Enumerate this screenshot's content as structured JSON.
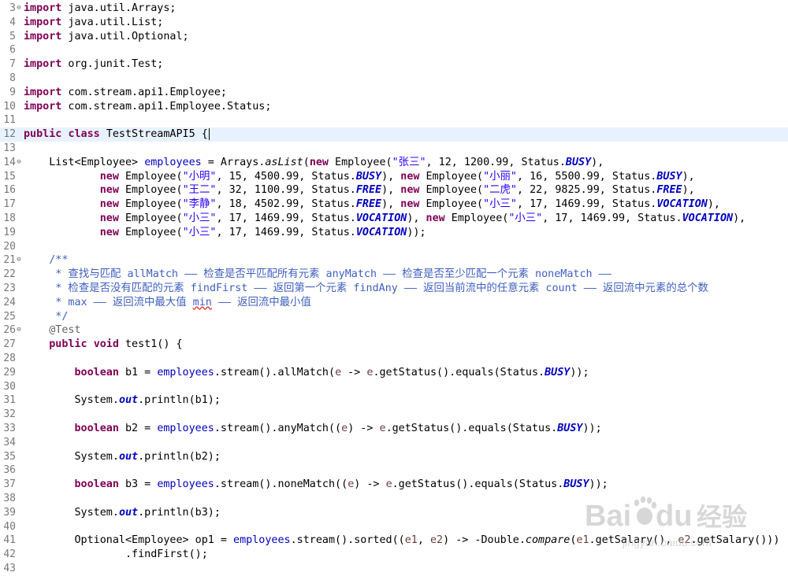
{
  "editor": {
    "lines": [
      {
        "n": "3",
        "fold": "⊖",
        "segments": [
          {
            "t": "import",
            "c": "k"
          },
          {
            "t": " java.util.Arrays;"
          }
        ]
      },
      {
        "n": "4",
        "segments": [
          {
            "t": "import",
            "c": "k"
          },
          {
            "t": " java.util.List;"
          }
        ]
      },
      {
        "n": "5",
        "segments": [
          {
            "t": "import",
            "c": "k"
          },
          {
            "t": " java.util.Optional;"
          }
        ]
      },
      {
        "n": "6",
        "segments": []
      },
      {
        "n": "7",
        "segments": [
          {
            "t": "import",
            "c": "k"
          },
          {
            "t": " org.junit.Test;"
          }
        ]
      },
      {
        "n": "8",
        "segments": []
      },
      {
        "n": "9",
        "segments": [
          {
            "t": "import",
            "c": "k"
          },
          {
            "t": " com.stream.api1.Employee;"
          }
        ]
      },
      {
        "n": "10",
        "segments": [
          {
            "t": "import",
            "c": "k"
          },
          {
            "t": " com.stream.api1.Employee.Status;"
          }
        ]
      },
      {
        "n": "11",
        "segments": []
      },
      {
        "n": "12",
        "current": true,
        "caret": true,
        "segments": [
          {
            "t": "public",
            "c": "k"
          },
          {
            "t": " "
          },
          {
            "t": "class",
            "c": "k"
          },
          {
            "t": " TestStreamAPI5 {"
          }
        ]
      },
      {
        "n": "13",
        "segments": []
      },
      {
        "n": "14",
        "fold": "⊖",
        "segments": [
          {
            "t": "    List<Employee> "
          },
          {
            "t": "employees",
            "c": "f"
          },
          {
            "t": " = Arrays."
          },
          {
            "t": "asList",
            "c": "m"
          },
          {
            "t": "("
          },
          {
            "t": "new",
            "c": "k"
          },
          {
            "t": " Employee("
          },
          {
            "t": "\"张三\"",
            "c": "s"
          },
          {
            "t": ", 12, 1200.99, Status."
          },
          {
            "t": "BUSY",
            "c": "fi"
          },
          {
            "t": "),"
          }
        ]
      },
      {
        "n": "15",
        "segments": [
          {
            "t": "            "
          },
          {
            "t": "new",
            "c": "k"
          },
          {
            "t": " Employee("
          },
          {
            "t": "\"小明\"",
            "c": "s"
          },
          {
            "t": ", 15, 4500.99, Status."
          },
          {
            "t": "BUSY",
            "c": "fi"
          },
          {
            "t": "), "
          },
          {
            "t": "new",
            "c": "k"
          },
          {
            "t": " Employee("
          },
          {
            "t": "\"小丽\"",
            "c": "s"
          },
          {
            "t": ", 16, 5500.99, Status."
          },
          {
            "t": "BUSY",
            "c": "fi"
          },
          {
            "t": "),"
          }
        ]
      },
      {
        "n": "16",
        "segments": [
          {
            "t": "            "
          },
          {
            "t": "new",
            "c": "k"
          },
          {
            "t": " Employee("
          },
          {
            "t": "\"王二\"",
            "c": "s"
          },
          {
            "t": ", 32, 1100.99, Status."
          },
          {
            "t": "FREE",
            "c": "fi"
          },
          {
            "t": "), "
          },
          {
            "t": "new",
            "c": "k"
          },
          {
            "t": " Employee("
          },
          {
            "t": "\"二虎\"",
            "c": "s"
          },
          {
            "t": ", 22, 9825.99, Status."
          },
          {
            "t": "FREE",
            "c": "fi"
          },
          {
            "t": "),"
          }
        ]
      },
      {
        "n": "17",
        "segments": [
          {
            "t": "            "
          },
          {
            "t": "new",
            "c": "k"
          },
          {
            "t": " Employee("
          },
          {
            "t": "\"李静\"",
            "c": "s"
          },
          {
            "t": ", 18, 4502.99, Status."
          },
          {
            "t": "FREE",
            "c": "fi"
          },
          {
            "t": "), "
          },
          {
            "t": "new",
            "c": "k"
          },
          {
            "t": " Employee("
          },
          {
            "t": "\"小三\"",
            "c": "s"
          },
          {
            "t": ", 17, 1469.99, Status."
          },
          {
            "t": "VOCATION",
            "c": "fi"
          },
          {
            "t": "),"
          }
        ]
      },
      {
        "n": "18",
        "segments": [
          {
            "t": "            "
          },
          {
            "t": "new",
            "c": "k"
          },
          {
            "t": " Employee("
          },
          {
            "t": "\"小三\"",
            "c": "s"
          },
          {
            "t": ", 17, 1469.99, Status."
          },
          {
            "t": "VOCATION",
            "c": "fi"
          },
          {
            "t": "), "
          },
          {
            "t": "new",
            "c": "k"
          },
          {
            "t": " Employee("
          },
          {
            "t": "\"小三\"",
            "c": "s"
          },
          {
            "t": ", 17, 1469.99, Status."
          },
          {
            "t": "VOCATION",
            "c": "fi"
          },
          {
            "t": "),"
          }
        ]
      },
      {
        "n": "19",
        "segments": [
          {
            "t": "            "
          },
          {
            "t": "new",
            "c": "k"
          },
          {
            "t": " Employee("
          },
          {
            "t": "\"小三\"",
            "c": "s"
          },
          {
            "t": ", 17, 1469.99, Status."
          },
          {
            "t": "VOCATION",
            "c": "fi"
          },
          {
            "t": "));"
          }
        ]
      },
      {
        "n": "20",
        "segments": []
      },
      {
        "n": "21",
        "fold": "⊖",
        "segments": [
          {
            "t": "    /**",
            "c": "c"
          }
        ]
      },
      {
        "n": "22",
        "segments": [
          {
            "t": "     * 查找与匹配 allMatch —— 检查是否平匹配所有元素 anyMatch —— 检查是否至少匹配一个元素 noneMatch ——",
            "c": "c"
          }
        ]
      },
      {
        "n": "23",
        "segments": [
          {
            "t": "     * 检查是否没有匹配的元素 findFirst —— 返回第一个元素 findAny —— 返回当前流中的任意元素 count —— 返回流中元素的总个数",
            "c": "c"
          }
        ]
      },
      {
        "n": "24",
        "segments": [
          {
            "t": "     * max —— 返回流中最大值 ",
            "c": "c"
          },
          {
            "t": "min",
            "c": "c sq"
          },
          {
            "t": " —— 返回流中最小值",
            "c": "c"
          }
        ]
      },
      {
        "n": "25",
        "segments": [
          {
            "t": "     */",
            "c": "c"
          }
        ]
      },
      {
        "n": "26",
        "fold": "⊖",
        "segments": [
          {
            "t": "    "
          },
          {
            "t": "@Test",
            "c": "a"
          }
        ]
      },
      {
        "n": "27",
        "segments": [
          {
            "t": "    "
          },
          {
            "t": "public",
            "c": "k"
          },
          {
            "t": " "
          },
          {
            "t": "void",
            "c": "k"
          },
          {
            "t": " test1() {"
          }
        ]
      },
      {
        "n": "28",
        "segments": []
      },
      {
        "n": "29",
        "segments": [
          {
            "t": "        "
          },
          {
            "t": "boolean",
            "c": "k"
          },
          {
            "t": " b1 = "
          },
          {
            "t": "employees",
            "c": "f"
          },
          {
            "t": ".stream().allMatch("
          },
          {
            "t": "e",
            "c": "v"
          },
          {
            "t": " -> "
          },
          {
            "t": "e",
            "c": "v"
          },
          {
            "t": ".getStatus().equals(Status."
          },
          {
            "t": "BUSY",
            "c": "fi"
          },
          {
            "t": "));"
          }
        ]
      },
      {
        "n": "30",
        "segments": []
      },
      {
        "n": "31",
        "segments": [
          {
            "t": "        System."
          },
          {
            "t": "out",
            "c": "fi"
          },
          {
            "t": ".println(b1);"
          }
        ]
      },
      {
        "n": "32",
        "segments": []
      },
      {
        "n": "33",
        "segments": [
          {
            "t": "        "
          },
          {
            "t": "boolean",
            "c": "k"
          },
          {
            "t": " b2 = "
          },
          {
            "t": "employees",
            "c": "f"
          },
          {
            "t": ".stream().anyMatch(("
          },
          {
            "t": "e",
            "c": "v"
          },
          {
            "t": ") -> "
          },
          {
            "t": "e",
            "c": "v"
          },
          {
            "t": ".getStatus().equals(Status."
          },
          {
            "t": "BUSY",
            "c": "fi"
          },
          {
            "t": "));"
          }
        ]
      },
      {
        "n": "34",
        "segments": []
      },
      {
        "n": "35",
        "segments": [
          {
            "t": "        System."
          },
          {
            "t": "out",
            "c": "fi"
          },
          {
            "t": ".println(b2);"
          }
        ]
      },
      {
        "n": "36",
        "segments": []
      },
      {
        "n": "37",
        "segments": [
          {
            "t": "        "
          },
          {
            "t": "boolean",
            "c": "k"
          },
          {
            "t": " b3 = "
          },
          {
            "t": "employees",
            "c": "f"
          },
          {
            "t": ".stream().noneMatch(("
          },
          {
            "t": "e",
            "c": "v"
          },
          {
            "t": ") -> "
          },
          {
            "t": "e",
            "c": "v"
          },
          {
            "t": ".getStatus().equals(Status."
          },
          {
            "t": "BUSY",
            "c": "fi"
          },
          {
            "t": "));"
          }
        ]
      },
      {
        "n": "38",
        "segments": []
      },
      {
        "n": "39",
        "segments": [
          {
            "t": "        System."
          },
          {
            "t": "out",
            "c": "fi"
          },
          {
            "t": ".println(b3);"
          }
        ]
      },
      {
        "n": "40",
        "segments": []
      },
      {
        "n": "41",
        "segments": [
          {
            "t": "        Optional<Employee> op1 = "
          },
          {
            "t": "employees",
            "c": "f"
          },
          {
            "t": ".stream().sorted(("
          },
          {
            "t": "e1",
            "c": "v"
          },
          {
            "t": ", "
          },
          {
            "t": "e2",
            "c": "v"
          },
          {
            "t": ") -> -Double."
          },
          {
            "t": "compare",
            "c": "m"
          },
          {
            "t": "("
          },
          {
            "t": "e1",
            "c": "v"
          },
          {
            "t": ".getSalary(), "
          },
          {
            "t": "e2",
            "c": "v"
          },
          {
            "t": ".getSalary()))"
          }
        ]
      },
      {
        "n": "42",
        "segments": [
          {
            "t": "                .findFirst();"
          }
        ]
      },
      {
        "n": "43",
        "segments": []
      }
    ]
  },
  "watermark": {
    "brand_text": "Bai",
    "brand_text2": "du",
    "suffix": "经验",
    "url": "jingyan.baidu.com"
  }
}
